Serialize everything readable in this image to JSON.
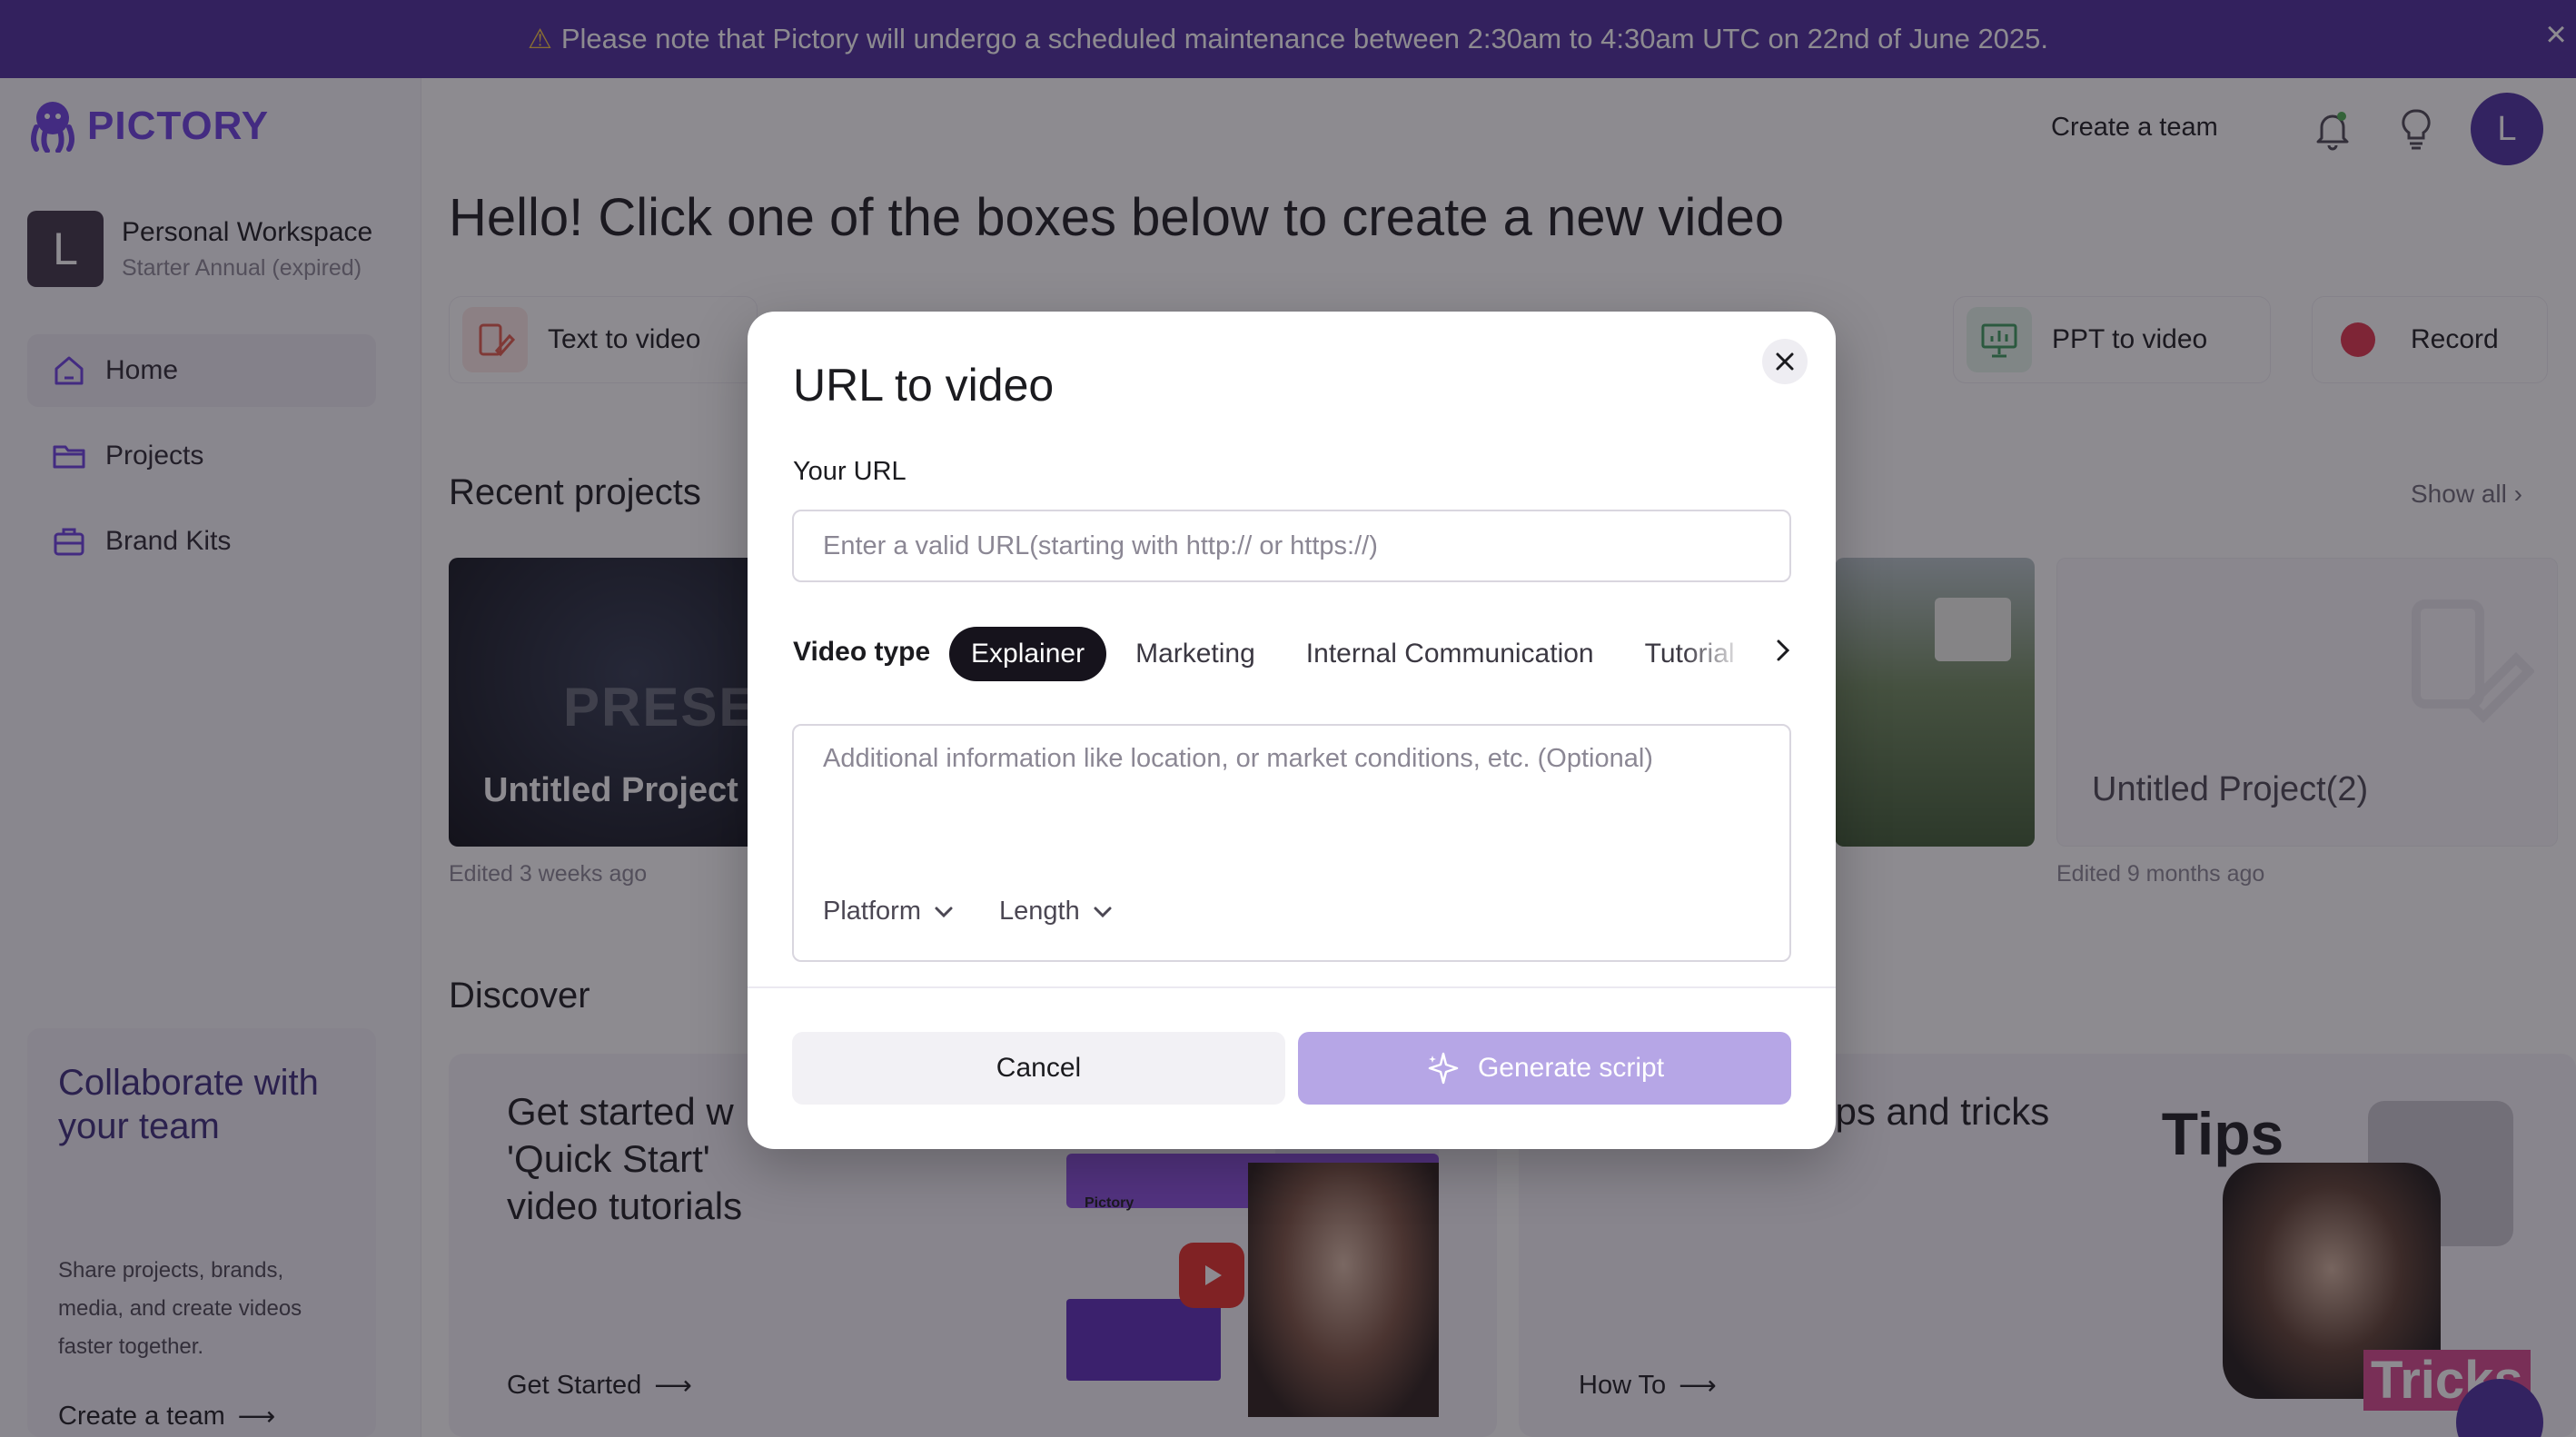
{
  "banner": {
    "text": "Please note that Pictory will undergo a scheduled maintenance between 2:30am to 4:30am UTC on 22nd of June 2025."
  },
  "brand": {
    "name": "PICTORY",
    "color": "#6a3ee0"
  },
  "workspace": {
    "initial": "L",
    "name": "Personal Workspace",
    "plan": "Starter Annual (expired)"
  },
  "sidebar": {
    "items": [
      {
        "label": "Home",
        "icon": "home-icon"
      },
      {
        "label": "Projects",
        "icon": "folder-icon"
      },
      {
        "label": "Brand Kits",
        "icon": "briefcase-icon"
      }
    ],
    "collab": {
      "title": "Collaborate with your team",
      "description": "Share projects, brands, media, and create videos faster together.",
      "link": "Create a team"
    }
  },
  "topbar": {
    "create_team": "Create a team",
    "user_initial": "L"
  },
  "main": {
    "heading": "Hello! Click one of the boxes below to create a new video",
    "video_types": [
      {
        "label": "Text to video",
        "icon": "text-to-video-icon"
      },
      {
        "label": "PPT to video",
        "icon": "presentation-icon"
      },
      {
        "label": "Record",
        "icon": "record-icon"
      }
    ],
    "recent_title": "Recent projects",
    "show_all": "Show all",
    "projects": [
      {
        "title": "Untitled Project",
        "thumb_text": "PRESENTA",
        "edited": "Edited 3 weeks ago"
      },
      {
        "title": "Untitled Project(2)",
        "edited": "Edited 9 months ago"
      }
    ],
    "discover_title": "Discover",
    "discover": [
      {
        "text": "Get started w 'Quick Start' video tutorials",
        "link": "Get Started",
        "thumb_label": "Pictory"
      },
      {
        "text": "deos with our tips and tricks",
        "link": "How To",
        "thumb_label": "Tips",
        "thumb_label2": "Tricks"
      }
    ]
  },
  "modal": {
    "title": "URL to video",
    "url_label": "Your URL",
    "url_placeholder": "Enter a valid URL(starting with http:// or https://)",
    "url_value": "",
    "video_type_label": "Video type",
    "video_types": [
      "Explainer",
      "Marketing",
      "Internal Communication",
      "Tutorial"
    ],
    "selected_video_type": "Explainer",
    "info_placeholder": "Additional information like location, or market conditions, etc. (Optional)",
    "platform_label": "Platform",
    "length_label": "Length",
    "cancel_label": "Cancel",
    "generate_label": "Generate script"
  }
}
